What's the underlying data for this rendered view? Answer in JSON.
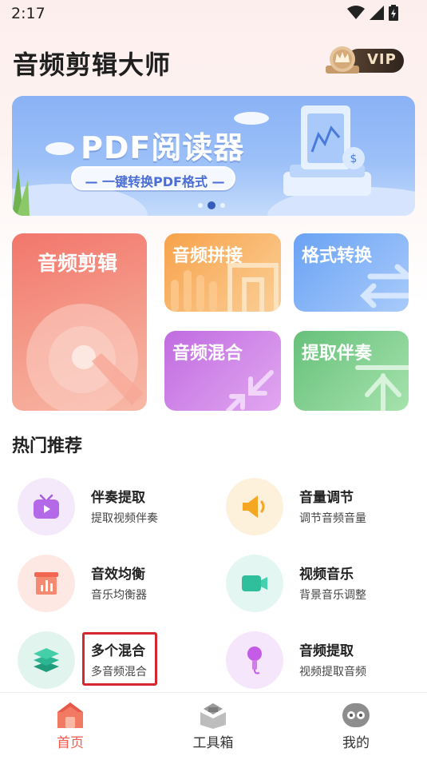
{
  "status": {
    "time": "2:17"
  },
  "header": {
    "title": "音频剪辑大师",
    "vip_label": "VIP"
  },
  "banner": {
    "title": "PDF阅读器",
    "subtitle": "— 一键转换PDF格式 —",
    "slide_count": 3,
    "active_slide": 2
  },
  "tiles": [
    {
      "label": "音频剪辑",
      "color": "#f2766b"
    },
    {
      "label": "音频拼接",
      "color": "#f7a24a"
    },
    {
      "label": "格式转换",
      "color": "#6aa2f4"
    },
    {
      "label": "音频混合",
      "color": "#c06ce0"
    },
    {
      "label": "提取伴奏",
      "color": "#66c07a"
    }
  ],
  "recommend": {
    "title": "热门推荐",
    "items": [
      {
        "title": "伴奏提取",
        "subtitle": "提取视频伴奏",
        "icon": "tv-play-icon"
      },
      {
        "title": "音量调节",
        "subtitle": "调节音频音量",
        "icon": "speaker-icon"
      },
      {
        "title": "音效均衡",
        "subtitle": "音乐均衡器",
        "icon": "equalizer-icon"
      },
      {
        "title": "视频音乐",
        "subtitle": "背景音乐调整",
        "icon": "video-camera-icon"
      },
      {
        "title": "多个混合",
        "subtitle": "多音频混合",
        "icon": "layers-icon"
      },
      {
        "title": "音频提取",
        "subtitle": "视频提取音频",
        "icon": "microphone-icon"
      }
    ]
  },
  "nav": {
    "items": [
      {
        "label": "首页",
        "icon": "home-icon",
        "active": true
      },
      {
        "label": "工具箱",
        "icon": "toolbox-icon",
        "active": false
      },
      {
        "label": "我的",
        "icon": "profile-icon",
        "active": false
      }
    ]
  },
  "colors": {
    "accent": "#ef5a4f",
    "highlight": "#d6272f"
  }
}
